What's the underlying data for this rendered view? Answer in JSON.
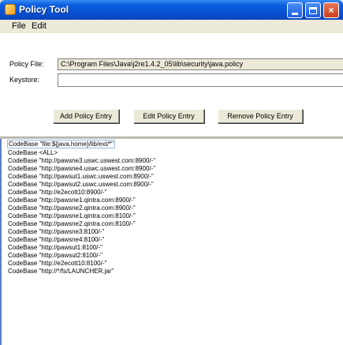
{
  "window": {
    "title": "Policy Tool",
    "controls": {
      "minimize": "",
      "maximize": "",
      "close": "×"
    }
  },
  "menu": {
    "items": [
      "File",
      "Edit"
    ]
  },
  "form": {
    "policy_file_label": "Policy File:",
    "policy_file_value": "C:\\Program Files\\Java\\j2re1.4.2_05\\lib\\security\\java.policy",
    "keystore_label": "Keystore:",
    "keystore_value": ""
  },
  "buttons": {
    "add": "Add Policy Entry",
    "edit": "Edit Policy Entry",
    "remove": "Remove Policy Entry"
  },
  "entries": [
    "CodeBase \"file:${java.home}/lib/ext/*\"",
    "CodeBase <ALL>",
    "CodeBase \"http://pawsne3.uswc.uswest.com:8900/-\"",
    "CodeBase \"http://pawsne4.uswc.uswest.com:8900/-\"",
    "CodeBase \"http://pawsut1.uswc.uswest.com:8900/-\"",
    "CodeBase \"http://pawsut2.uswc.uswest.com:8900/-\"",
    "CodeBase \"http://e2ecott10:8900/-\"",
    "CodeBase \"http://pawsne1.qintra.com:8900/-\"",
    "CodeBase \"http://pawsne2.qintra.com:8900/-\"",
    "CodeBase \"http://pawsne1.qintra.com:8100/-\"",
    "CodeBase \"http://pawsne2.qintra.com:8100/-\"",
    "CodeBase \"http://pawsne3:8100/-\"",
    "CodeBase \"http://pawsne4:8100/-\"",
    "CodeBase \"http://pawsut1:8100/-\"",
    "CodeBase \"http://pawsut2:8100/-\"",
    "CodeBase \"http://e2ecott10:8100/-\"",
    "CodeBase \"http://*/fs/LAUNCHER.jar\""
  ]
}
